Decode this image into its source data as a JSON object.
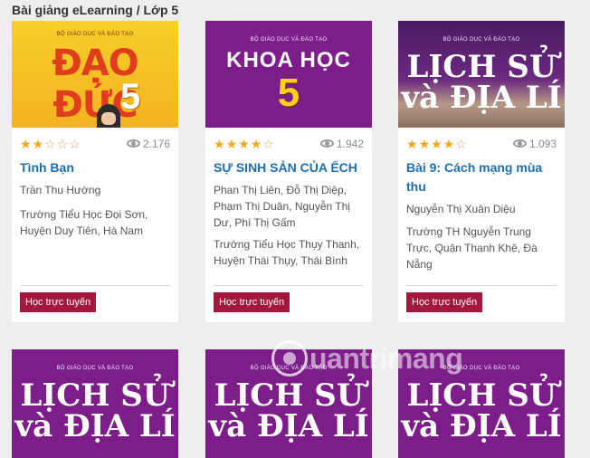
{
  "breadcrumb": "Bài giảng eLearning / Lớp 5",
  "colors": {
    "link": "#1d6fb0",
    "button": "#a3183c",
    "star": "#f2a71f"
  },
  "cards": [
    {
      "cover": {
        "publisher": "BỘ GIÁO DỤC VÀ ĐÀO TẠO",
        "title": "ĐẠO ĐỨC",
        "grade": "5"
      },
      "rating": 2,
      "rating_max": 5,
      "views": "2.176",
      "title": "Tình Bạn",
      "author": "Trần Thu Hường",
      "school": "Trường Tiểu Học Đọi Sơn, Huyện Duy Tiên, Hà Nam",
      "button": "Học trực tuyến"
    },
    {
      "cover": {
        "publisher": "BỘ GIÁO DỤC VÀ ĐÀO TẠO",
        "title": "KHOA HỌC",
        "grade": "5"
      },
      "rating": 4,
      "rating_max": 5,
      "views": "1.942",
      "title": "SỰ SINH SẢN CỦA ẾCH",
      "author": "Phan Thị Liên, Đỗ Thị Diệp, Phạm Thị Duân, Nguyễn Thị Dư, Phí Thị Gấm",
      "school": "Trường Tiểu Học Thụy Thanh, Huyện Thái Thụy, Thái Bình",
      "button": "Học trực tuyến"
    },
    {
      "cover": {
        "publisher": "BỘ GIÁO DỤC VÀ ĐÀO TẠO",
        "title_line1": "LỊCH SỬ",
        "title_line2": "và ĐỊA LÍ"
      },
      "rating": 4,
      "rating_max": 5,
      "views": "1.093",
      "title": "Bài 9: Cách mạng mùa thu",
      "author": "Nguyễn Thị Xuân Diệu",
      "school": "Trường TH Nguyễn Trung Trực, Quận Thanh Khê, Đà Nẵng",
      "button": "Học trực tuyến"
    }
  ],
  "row2_covers": [
    {
      "publisher": "BỘ GIÁO DỤC VÀ ĐÀO TẠO",
      "title_line1": "LỊCH SỬ",
      "title_line2": "và ĐỊA LÍ"
    },
    {
      "publisher": "BỘ GIÁO DỤC VÀ ĐÀO TẠO",
      "title_line1": "LỊCH SỬ",
      "title_line2": "và ĐỊA LÍ"
    },
    {
      "publisher": "BỘ GIÁO DỤC VÀ ĐÀO TẠO",
      "title_line1": "LỊCH SỬ",
      "title_line2": "và ĐỊA LÍ"
    }
  ],
  "watermark": "uantrimang"
}
